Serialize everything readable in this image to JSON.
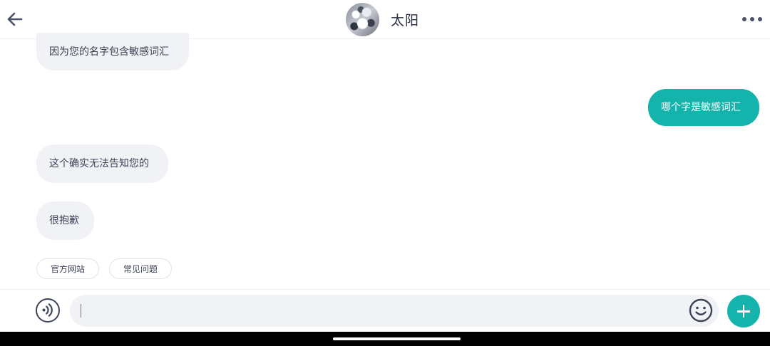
{
  "header": {
    "title": "太阳",
    "back_icon": "arrow-left-icon",
    "more_icon": "more-horizontal-icon"
  },
  "messages": [
    {
      "side": "in",
      "text": "因为您的名字包含敏感词汇"
    },
    {
      "side": "out",
      "text": "哪个字是敏感词汇"
    },
    {
      "side": "in",
      "text": "这个确实无法告知您的"
    },
    {
      "side": "in",
      "text": "很抱歉"
    }
  ],
  "quick_replies": [
    "官方网站",
    "常见问题"
  ],
  "composer": {
    "value": "",
    "voice_icon": "voice-icon",
    "emoji_icon": "emoji-icon",
    "plus_icon": "plus-icon"
  },
  "colors": {
    "accent": "#14b3ac",
    "incoming_bubble": "#f0f2f6",
    "text": "#3c4254"
  }
}
